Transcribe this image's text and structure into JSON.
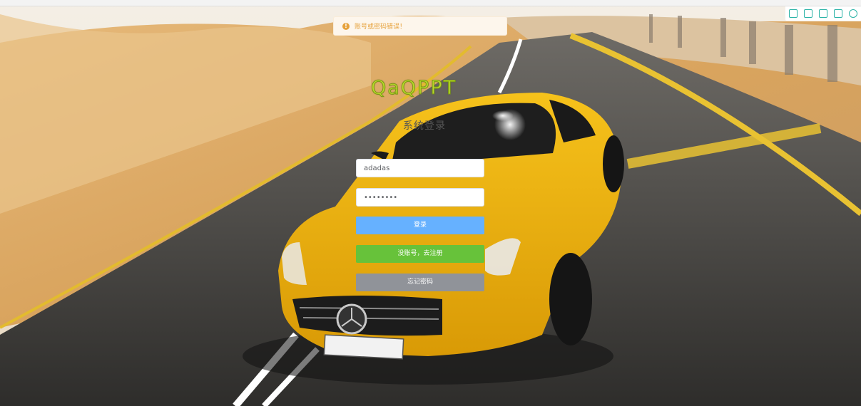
{
  "alert": {
    "message": "账号或密码错误！",
    "color": "#e6a23c"
  },
  "logo": {
    "text": "QaQPPT"
  },
  "title": "系统登录",
  "form": {
    "username_value": "adadas",
    "password_value": "••••••••"
  },
  "buttons": {
    "login": "登录",
    "register": "没账号，去注册",
    "forgot": "忘记密码"
  },
  "colors": {
    "login": "#66b1ff",
    "register": "#67c23a",
    "forgot": "#909399"
  },
  "toolbar_icons": [
    "bookmark-icon",
    "fullscreen-icon",
    "save-icon",
    "share-icon",
    "settings-icon"
  ]
}
